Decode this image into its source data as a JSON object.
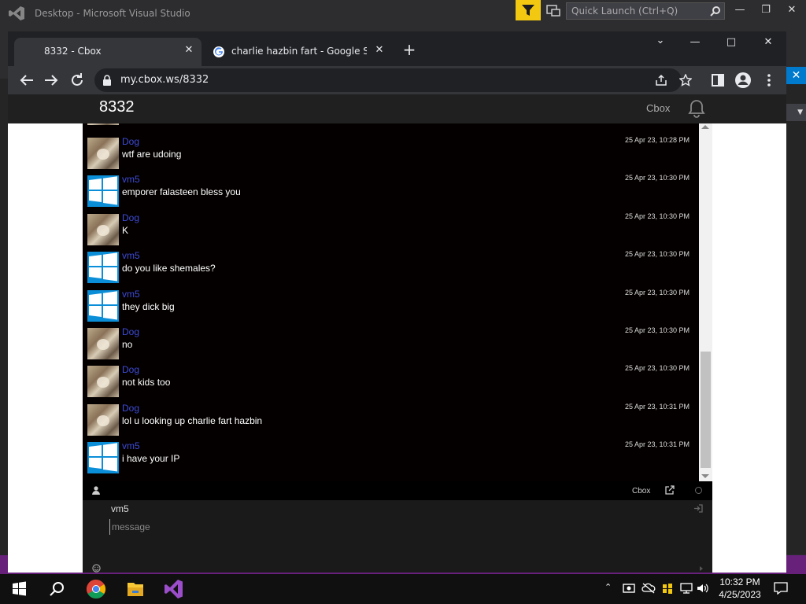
{
  "vs": {
    "title": "Desktop - Microsoft Visual Studio",
    "quick_launch_placeholder": "Quick Launch (Ctrl+Q)",
    "colors": {
      "accent": "#007acc",
      "status": "#68217a",
      "filter": "#f2c811"
    }
  },
  "browser": {
    "tabs": [
      {
        "title": "8332 - Cbox",
        "active": true
      },
      {
        "title": "charlie hazbin fart - Google Searc",
        "active": false,
        "favicon": "google-icon"
      }
    ],
    "url": "my.cbox.ws/8332",
    "colors": {
      "frame": "#202124",
      "toolbar": "#35363a"
    }
  },
  "cbox": {
    "room_title": "8332",
    "brand": "Cbox",
    "footer_brand": "Cbox",
    "post_name": "vm5",
    "message_placeholder": "message",
    "colors": {
      "username": "#3b4bd8",
      "background": "#050000",
      "text": "#ffffff"
    },
    "messages": [
      {
        "user": "Dog",
        "avatar": "dog",
        "text": "wtf are udoing",
        "time": "25 Apr 23, 10:28 PM"
      },
      {
        "user": "vm5",
        "avatar": "windows",
        "text": "emporer falasteen bless you",
        "time": "25 Apr 23, 10:30 PM"
      },
      {
        "user": "Dog",
        "avatar": "dog",
        "text": "K",
        "time": "25 Apr 23, 10:30 PM"
      },
      {
        "user": "vm5",
        "avatar": "windows",
        "text": "do you like shemales?",
        "time": "25 Apr 23, 10:30 PM"
      },
      {
        "user": "vm5",
        "avatar": "windows",
        "text": "they dick big",
        "time": "25 Apr 23, 10:30 PM"
      },
      {
        "user": "Dog",
        "avatar": "dog",
        "text": "no",
        "time": "25 Apr 23, 10:30 PM"
      },
      {
        "user": "Dog",
        "avatar": "dog",
        "text": "not kids too",
        "time": "25 Apr 23, 10:30 PM"
      },
      {
        "user": "Dog",
        "avatar": "dog",
        "text": "lol u looking up charlie fart hazbin",
        "time": "25 Apr 23, 10:31 PM"
      },
      {
        "user": "vm5",
        "avatar": "windows",
        "text": "i have your IP",
        "time": "25 Apr 23, 10:31 PM"
      }
    ]
  },
  "taskbar": {
    "apps": [
      "start-icon",
      "search-icon",
      "chrome-icon",
      "file-explorer-icon",
      "visual-studio-icon"
    ],
    "time": "10:32 PM",
    "date": "4/25/2023"
  }
}
